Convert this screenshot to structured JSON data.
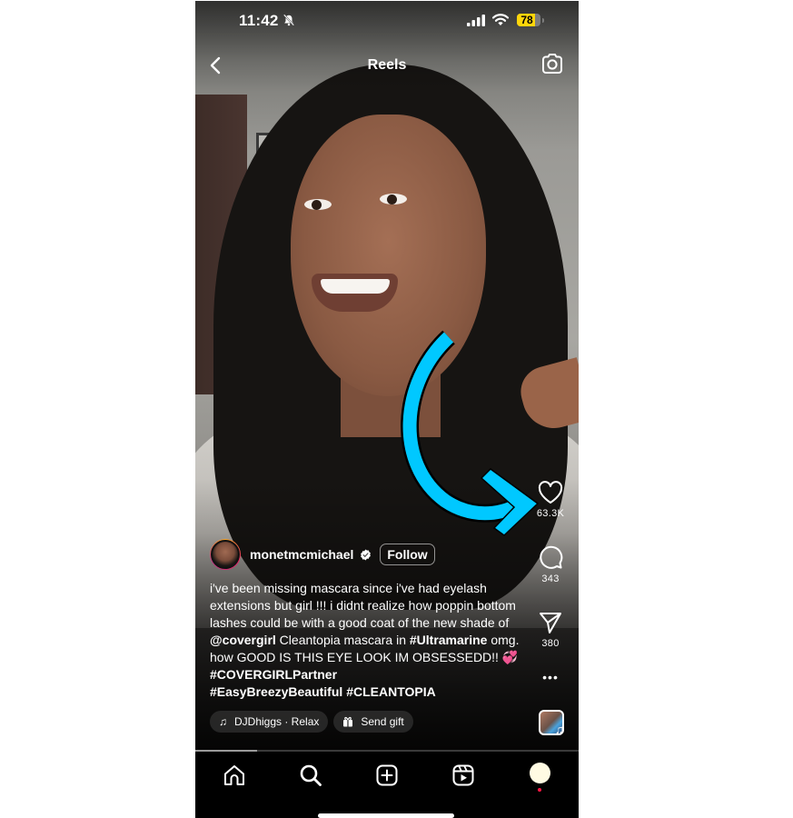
{
  "status_bar": {
    "time": "11:42",
    "silent_mode": true,
    "battery_percent": "78",
    "battery_level": 0.78,
    "battery_color": "#ffd60a"
  },
  "header": {
    "title": "Reels",
    "back_icon": "chevron-left-icon",
    "camera_icon": "camera-icon"
  },
  "reel": {
    "author": {
      "username": "monetmcmichael",
      "verified": true,
      "follow_label": "Follow"
    },
    "caption": {
      "line1": "i've been missing mascara since i've had eyelash extensions but girl !!! i didnt realize how poppin bottom lashes could be with a good coat of the new shade of ",
      "mention": "@covergirl",
      "line2": " Cleantopia mascara in ",
      "tag1": "#Ultramarine",
      "line3": " omg. how GOOD IS THIS EYE LOOK IM OBSESSEDD!! ",
      "emoji": "💞",
      "tag2": "#COVERGIRLPartner",
      "tag3": "#EasyBreezyBeautiful",
      "tag4": "#CLEANTOPIA"
    },
    "audio_label": "DJDhiggs · Relax",
    "gift_label": "Send gift",
    "progress": 0.16
  },
  "actions": {
    "likes": "63.3K",
    "comments": "343",
    "shares": "380",
    "more_label": "•••"
  },
  "annotation": {
    "arrow_color": "#00c8ff",
    "points_to": "like-button"
  },
  "tabbar": {
    "items": [
      "home",
      "search",
      "create",
      "reels",
      "profile"
    ],
    "profile_color": "#fffbe3",
    "notification_dot_color": "#ff1744"
  }
}
